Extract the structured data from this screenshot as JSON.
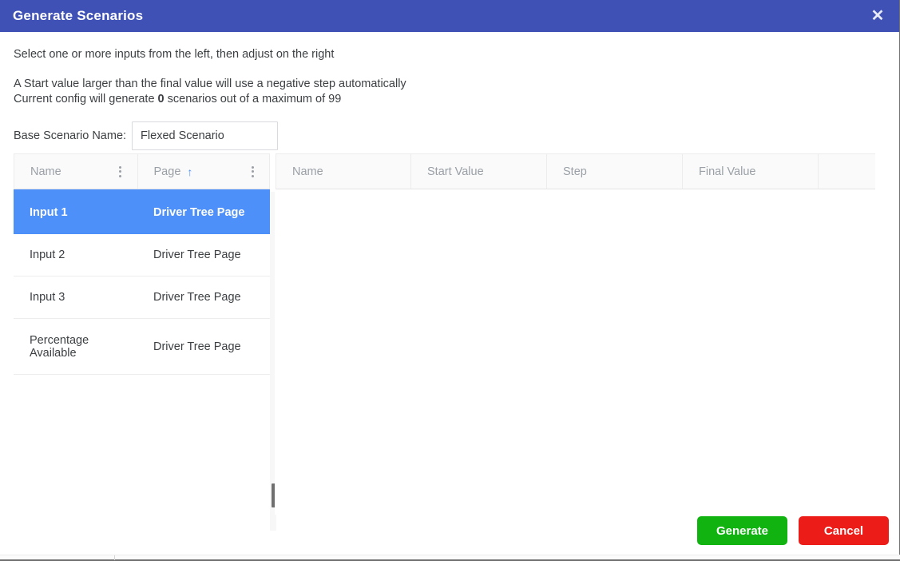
{
  "dialog": {
    "title": "Generate Scenarios",
    "close_icon": "close-icon",
    "close_glyph": "✕",
    "header_color": "#3f51b5"
  },
  "intro": {
    "line1": "Select one or more inputs from the left, then adjust on the right",
    "line2": "A Start value larger than the final value will use a negative step automatically",
    "line3_prefix": "Current config will generate ",
    "line3_count": "0",
    "line3_suffix": " scenarios out of a maximum of 99"
  },
  "base_scenario": {
    "label": "Base Scenario Name:",
    "value": "Flexed Scenario",
    "placeholder": "Base Scenario Name"
  },
  "left_grid": {
    "columns": [
      {
        "label": "Name",
        "sorted": false,
        "menu_icon": "kebab-menu-icon"
      },
      {
        "label": "Page",
        "sorted": true,
        "sort_glyph": "↑",
        "menu_icon": "kebab-menu-icon"
      }
    ],
    "rows": [
      {
        "name": "Input 1",
        "page": "Driver Tree Page",
        "selected": true
      },
      {
        "name": "Input 2",
        "page": "Driver Tree Page",
        "selected": false
      },
      {
        "name": "Input 3",
        "page": "Driver Tree Page",
        "selected": false
      },
      {
        "name": "Percentage Available",
        "page": "Driver Tree Page",
        "selected": false
      }
    ],
    "selection_color": "#4d90fa"
  },
  "right_grid": {
    "columns": [
      {
        "label": "Name"
      },
      {
        "label": "Start Value"
      },
      {
        "label": "Step"
      },
      {
        "label": "Final Value"
      },
      {
        "label": ""
      }
    ],
    "rows": []
  },
  "footer": {
    "generate_label": "Generate",
    "generate_color": "#10b310",
    "cancel_label": "Cancel",
    "cancel_color": "#ec1c18"
  }
}
